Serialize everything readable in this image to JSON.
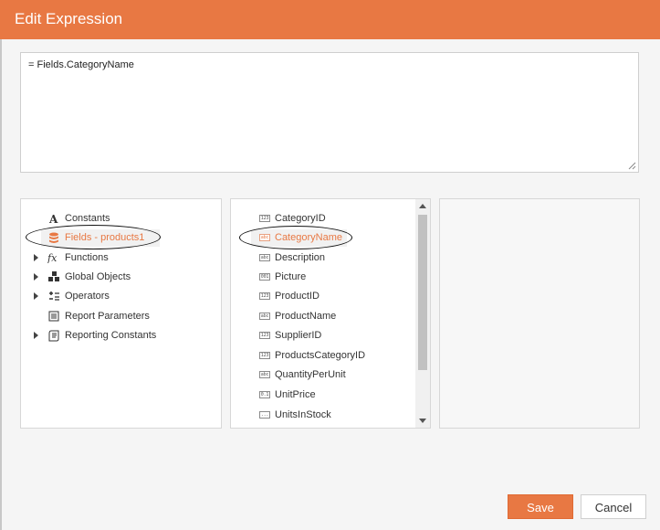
{
  "dialog": {
    "title": "Edit Expression"
  },
  "expression": {
    "value": "= Fields.CategoryName"
  },
  "categories": [
    {
      "label": "Constants",
      "icon": "letter-a-icon",
      "expandable": false,
      "selected": false
    },
    {
      "label": "Fields - products1",
      "icon": "database-icon",
      "expandable": false,
      "selected": true
    },
    {
      "label": "Functions",
      "icon": "fx-icon",
      "expandable": true,
      "selected": false
    },
    {
      "label": "Global Objects",
      "icon": "objects-icon",
      "expandable": true,
      "selected": false
    },
    {
      "label": "Operators",
      "icon": "operators-icon",
      "expandable": true,
      "selected": false
    },
    {
      "label": "Report Parameters",
      "icon": "parameters-icon",
      "expandable": false,
      "selected": false
    },
    {
      "label": "Reporting Constants",
      "icon": "document-icon",
      "expandable": true,
      "selected": false
    }
  ],
  "fields": [
    {
      "label": "CategoryID",
      "type_badge": "123",
      "selected": false
    },
    {
      "label": "CategoryName",
      "type_badge": "abc",
      "selected": true
    },
    {
      "label": "Description",
      "type_badge": "abc",
      "selected": false
    },
    {
      "label": "Picture",
      "type_badge": "001",
      "selected": false
    },
    {
      "label": "ProductID",
      "type_badge": "123",
      "selected": false
    },
    {
      "label": "ProductName",
      "type_badge": "abc",
      "selected": false
    },
    {
      "label": "SupplierID",
      "type_badge": "123",
      "selected": false
    },
    {
      "label": "ProductsCategoryID",
      "type_badge": "123",
      "selected": false
    },
    {
      "label": "QuantityPerUnit",
      "type_badge": "abc",
      "selected": false
    },
    {
      "label": "UnitPrice",
      "type_badge": "0.1",
      "selected": false
    },
    {
      "label": "UnitsInStock",
      "type_badge": "...",
      "selected": false
    }
  ],
  "buttons": {
    "save": "Save",
    "cancel": "Cancel"
  },
  "colors": {
    "accent": "#e87843",
    "selected_text": "#e87843"
  }
}
